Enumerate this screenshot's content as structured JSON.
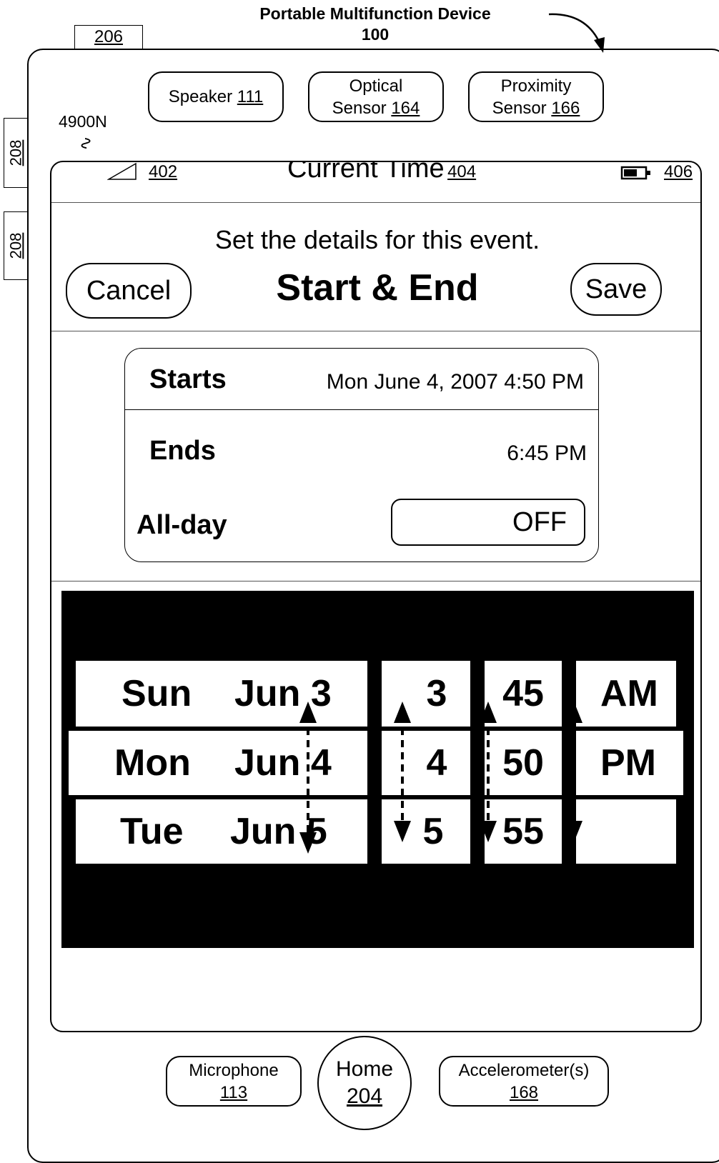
{
  "device": {
    "title": "Portable Multifunction Device",
    "number": "100",
    "ref_top_tab": "206",
    "ref_side_tab_1": "208",
    "ref_side_tab_2": "208",
    "screen_ref": "4900N",
    "screen_ref_mark": "∿"
  },
  "hardware_top": {
    "speaker_label": "Speaker",
    "speaker_num": "111",
    "optical_line1": "Optical",
    "optical_line2": "Sensor",
    "optical_num": "164",
    "proximity_line1": "Proximity",
    "proximity_line2": "Sensor",
    "proximity_num": "166"
  },
  "status_bar": {
    "signal_ref": "402",
    "time_label": "Current Time",
    "time_ref": "404",
    "battery_ref": "406"
  },
  "header": {
    "prompt": "Set the details for this event.",
    "title": "Start & End",
    "cancel_label": "Cancel",
    "save_label": "Save"
  },
  "details": {
    "starts_label": "Starts",
    "starts_value": "Mon June 4, 2007 4:50 PM",
    "ends_label": "Ends",
    "ends_value": "6:45 PM",
    "allday_label": "All-day",
    "allday_value": "OFF"
  },
  "picker": {
    "day_rows": [
      {
        "day": "Sun",
        "date": "Jun 3"
      },
      {
        "day": "Mon",
        "date": "Jun 4"
      },
      {
        "day": "Tue",
        "date": "Jun 5"
      }
    ],
    "hours": [
      "3",
      "4",
      "5"
    ],
    "minutes": [
      "45",
      "50",
      "55"
    ],
    "meridiem": [
      "AM",
      "PM",
      ""
    ]
  },
  "hardware_bottom": {
    "microphone_label": "Microphone",
    "microphone_num": "113",
    "home_label": "Home",
    "home_num": "204",
    "accel_label": "Accelerometer(s)",
    "accel_num": "168"
  }
}
